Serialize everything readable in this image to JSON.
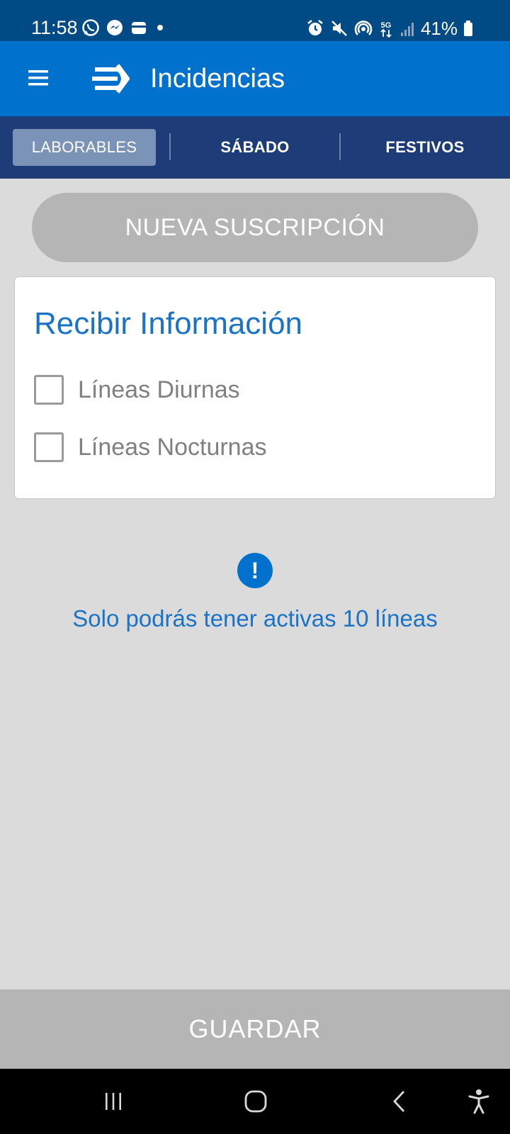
{
  "status_bar": {
    "time": "11:58",
    "battery": "41%",
    "network": "5G",
    "left_icons": [
      "whatsapp-icon",
      "messenger-icon",
      "wallet-icon",
      "dot-icon"
    ],
    "right_icons": [
      "alarm-icon",
      "mute-icon",
      "hotspot-icon",
      "network-5g-icon",
      "signal-icon",
      "battery-icon"
    ]
  },
  "app_bar": {
    "title": "Incidencias",
    "menu_icon": "hamburger-menu-icon",
    "logo_icon": "brand-arrow-logo-icon",
    "color": "#0072ce"
  },
  "tabs": [
    {
      "label": "LABORABLES",
      "active": true
    },
    {
      "label": "SÁBADO",
      "active": false
    },
    {
      "label": "FESTIVOS",
      "active": false
    }
  ],
  "new_subscription_label": "NUEVA SUSCRIPCIÓN",
  "card": {
    "title": "Recibir Información",
    "options": [
      {
        "label": "Líneas Diurnas",
        "checked": false
      },
      {
        "label": "Líneas Nocturnas",
        "checked": false
      }
    ]
  },
  "info": {
    "icon": "exclamation-icon",
    "symbol": "!",
    "text": "Solo podrás tener activas 10 líneas"
  },
  "save_label": "GUARDAR",
  "nav_bar": {
    "buttons": [
      "recent-apps-icon",
      "home-icon",
      "back-icon",
      "accessibility-icon"
    ]
  },
  "colors": {
    "accent": "#0072ce",
    "status_bar": "#004a85",
    "tab_bar": "#1d3c78",
    "active_tab": "#7c93b8",
    "disabled_button": "#b5b5b5",
    "background": "#dbdbdb",
    "info_text": "#1a73c6"
  }
}
